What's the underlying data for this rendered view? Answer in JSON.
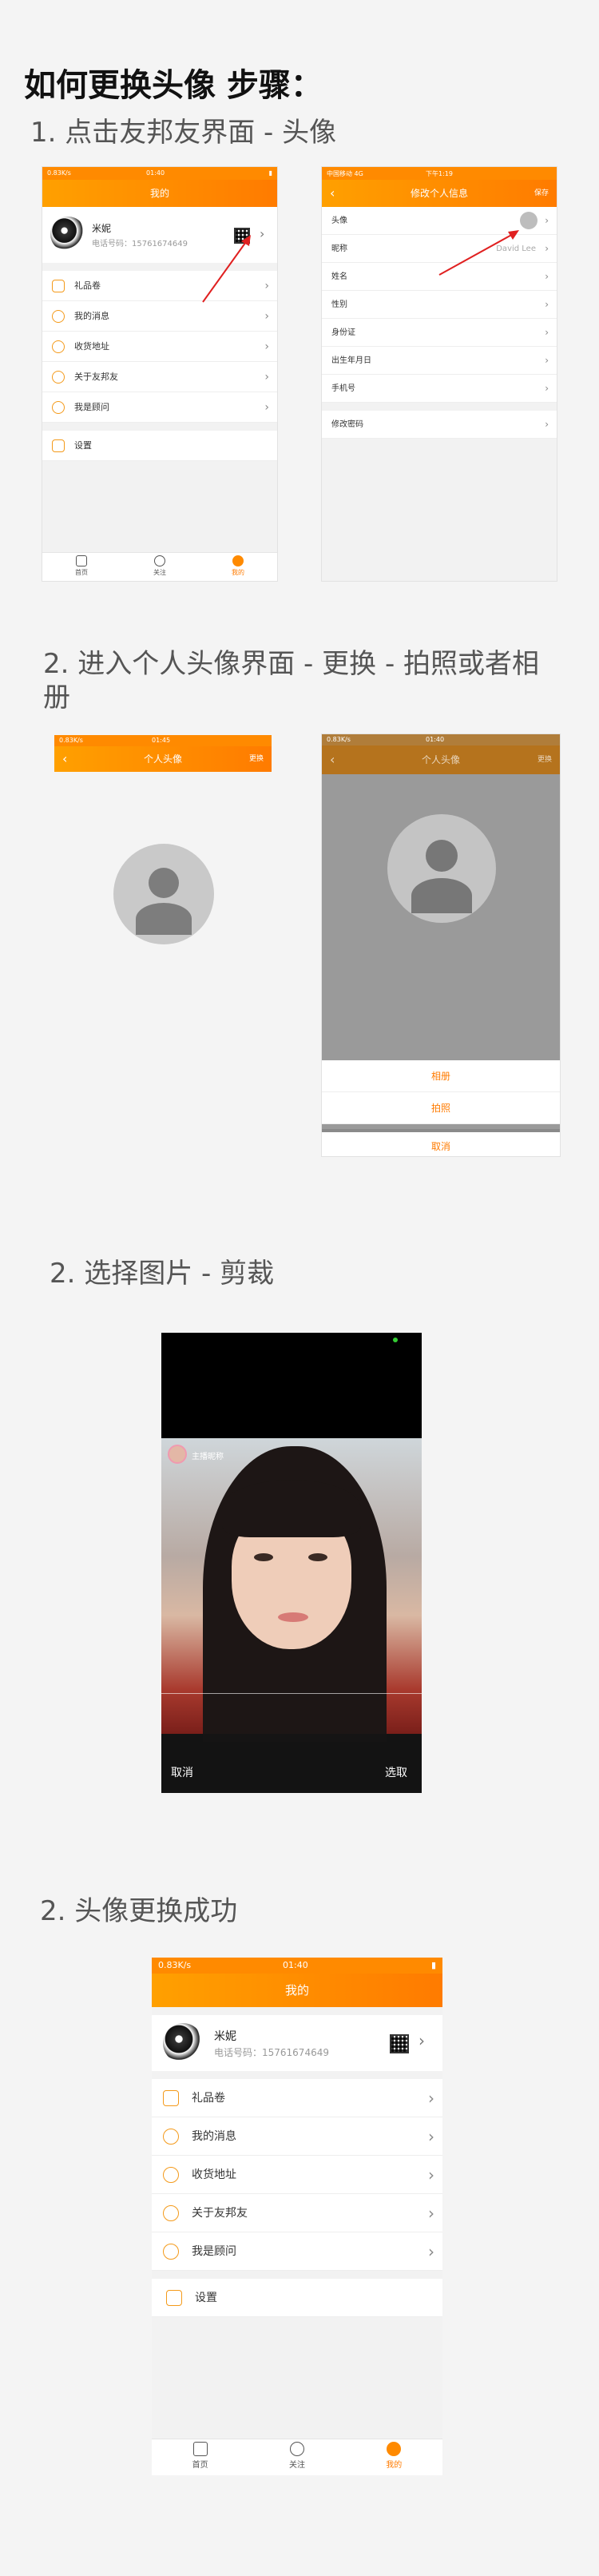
{
  "main_title": "如何更换头像  步骤：",
  "steps": {
    "s1": "1. 点击友邦友界面 - 头像",
    "s2": "2. 进入个人头像界面 - 更换 - 拍照或者相册",
    "s3": "2. 选择图片 - 剪裁",
    "s4": "2. 头像更换成功"
  },
  "status": {
    "left": "0.83K/s",
    "time": "01:40",
    "time2": "01:45",
    "carrier": "中国移动 4G",
    "time_b": "下午1:19"
  },
  "my_page": {
    "title": "我的",
    "user_name": "米妮",
    "user_phone": "电话号码：15761674649",
    "menu": [
      "礼品卷",
      "我的消息",
      "收货地址",
      "关于友邦友",
      "我是顾问"
    ],
    "settings": "设置",
    "tabs": [
      "首页",
      "关注",
      "我的"
    ]
  },
  "edit_page": {
    "title": "修改个人信息",
    "save": "保存",
    "rows": [
      "头像",
      "昵称",
      "姓名",
      "性别",
      "身份证",
      "出生年月日",
      "手机号"
    ],
    "nickname_value": "David Lee",
    "change_password": "修改密码"
  },
  "avatar_page": {
    "title": "个人头像",
    "change": "更换",
    "sheet": [
      "相册",
      "拍照",
      "取消"
    ]
  },
  "crop_page": {
    "cancel": "取消",
    "choose": "选取",
    "overlay_name": "主播昵称"
  }
}
